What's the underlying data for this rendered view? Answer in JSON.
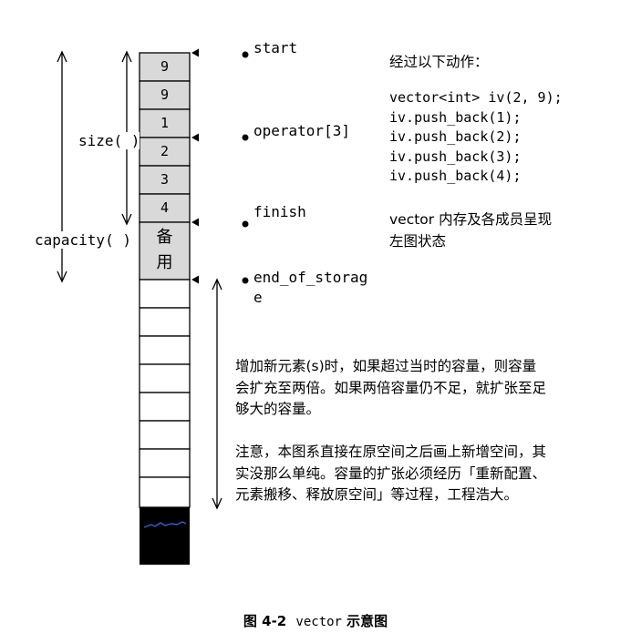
{
  "cells": [
    "9",
    "9",
    "1",
    "2",
    "3",
    "4"
  ],
  "spare_label": [
    "备",
    "用"
  ],
  "labels": {
    "size": "size( )",
    "capacity": "capacity( )"
  },
  "pointers": {
    "start": "start",
    "operator": "operator[3]",
    "finish": "finish",
    "end_of_storage_1": "end_of_storag",
    "end_of_storage_2": "e"
  },
  "code": {
    "heading": "经过以下动作：",
    "lines": [
      "vector<int> iv(2, 9);",
      "iv.push_back(1);",
      "iv.push_back(2);",
      "iv.push_back(3);",
      "iv.push_back(4);"
    ],
    "summary_1": "vector 内存及各成员呈现",
    "summary_2": "左图状态"
  },
  "notes": {
    "para1_line1": "增加新元素(s)时，如果超过当时的容量，则容量",
    "para1_line2": "会扩充至两倍。如果两倍容量仍不足，就扩张至足",
    "para1_line3": "够大的容量。",
    "para2_line1": "注意，本图系直接在原空间之后画上新增空间，其",
    "para2_line2": "实没那么单纯。容量的扩张必须经历「重新配置、",
    "para2_line3": "元素搬移、释放原空间」等过程，工程浩大。"
  },
  "caption": {
    "fig": "图 4-2",
    "name": "vector",
    "desc": "示意图"
  }
}
